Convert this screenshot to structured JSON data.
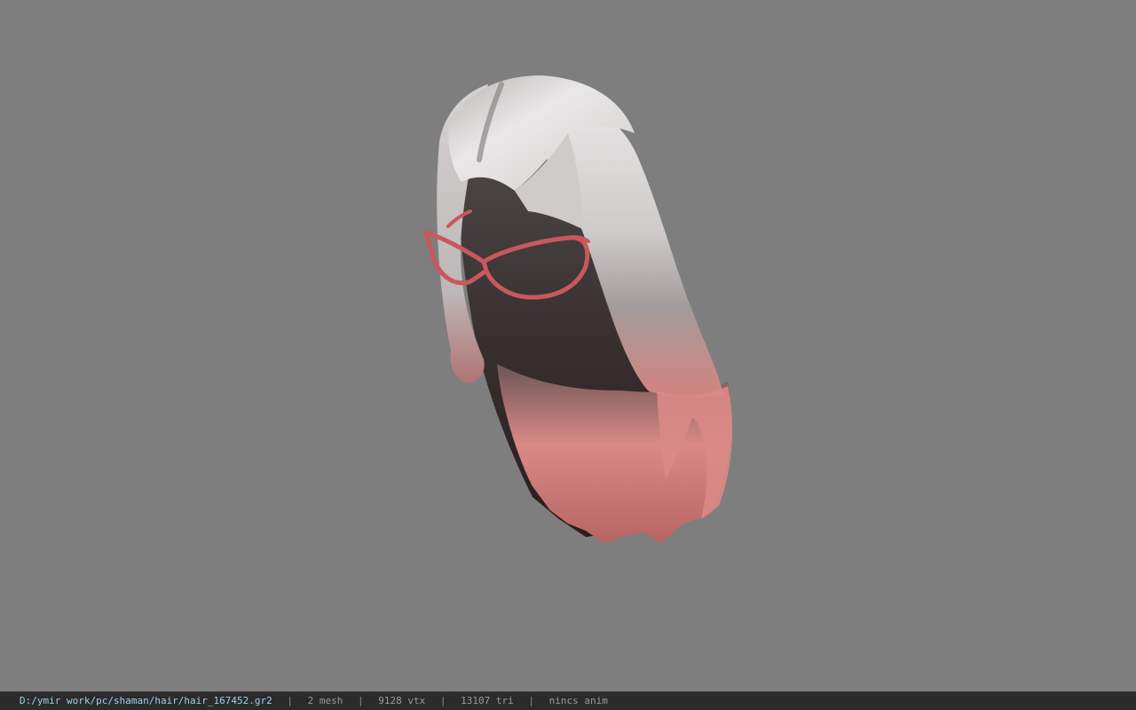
{
  "viewer": {
    "file_path": "D:/ymir work/pc/shaman/hair/hair_167452.gr2",
    "mesh_count": "2 mesh",
    "vertex_count": "9128 vtx",
    "triangle_count": "13107 tri",
    "anim_status": "nincs anim",
    "separator": "|"
  },
  "model": {
    "hair_root_color": "#d9d4d3",
    "hair_tip_color": "#d98585",
    "hair_shadow_color": "#3a2e2e",
    "glasses_color": "#c9585c",
    "viewport_bg": "#7e7e7e"
  }
}
